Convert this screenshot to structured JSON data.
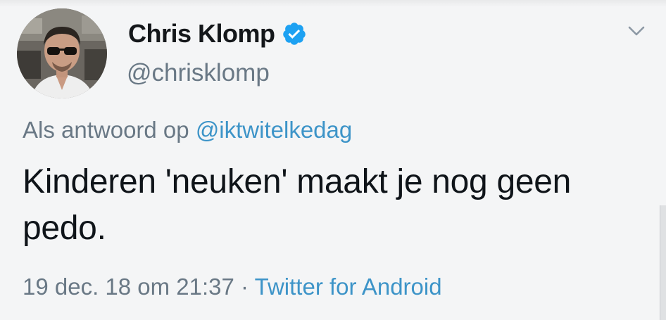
{
  "tweet": {
    "display_name": "Chris Klomp",
    "handle": "@chrisklomp",
    "verified": true,
    "reply_prefix": "Als antwoord op ",
    "reply_to": "@iktwitelkedag",
    "text": "Kinderen 'neuken' maakt je nog geen pedo.",
    "timestamp": "19 dec. 18 om 21:37",
    "separator": " · ",
    "source": "Twitter for Android"
  },
  "icons": {
    "verified": "verified-badge-icon",
    "menu": "chevron-down-icon",
    "avatar": "avatar"
  },
  "colors": {
    "link_blue": "#3d94c8",
    "verified_blue": "#1da1f2",
    "secondary_gray": "#697885",
    "text": "#0f1419",
    "background": "#f4f5f6"
  }
}
